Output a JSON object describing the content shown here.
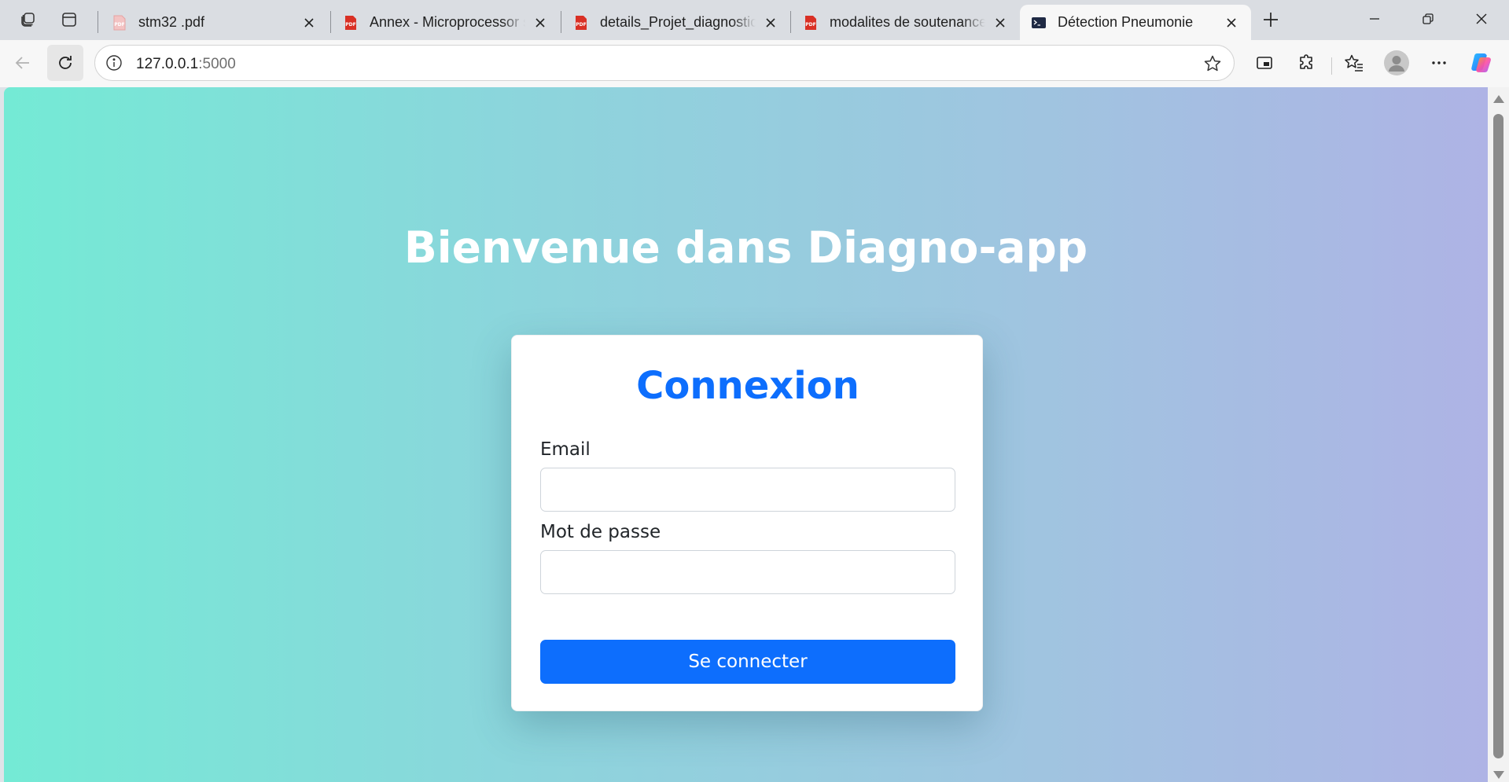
{
  "browser": {
    "tabs": [
      {
        "title": "stm32 .pdf",
        "favicon": "pdf-icon-faded",
        "active": false
      },
      {
        "title": "Annex - Microprocessor s",
        "favicon": "pdf-icon",
        "active": false
      },
      {
        "title": "details_Projet_diagnostic_",
        "favicon": "pdf-icon",
        "active": false
      },
      {
        "title": "modalites de soutenance",
        "favicon": "pdf-icon",
        "active": false
      },
      {
        "title": "Détection Pneumonie",
        "favicon": "terminal-icon",
        "active": true
      }
    ],
    "pdf_badge": "PDF",
    "address": {
      "host": "127.0.0.1",
      "port": ":5000"
    },
    "accent_color": "#0d6efd"
  },
  "page": {
    "heading": "Bienvenue dans Diagno-app",
    "background_gradient": [
      "#74ead5",
      "#aeb3e5"
    ]
  },
  "login": {
    "title": "Connexion",
    "email_label": "Email",
    "email_value": "",
    "password_label": "Mot de passe",
    "password_value": "",
    "submit_label": "Se connecter"
  }
}
